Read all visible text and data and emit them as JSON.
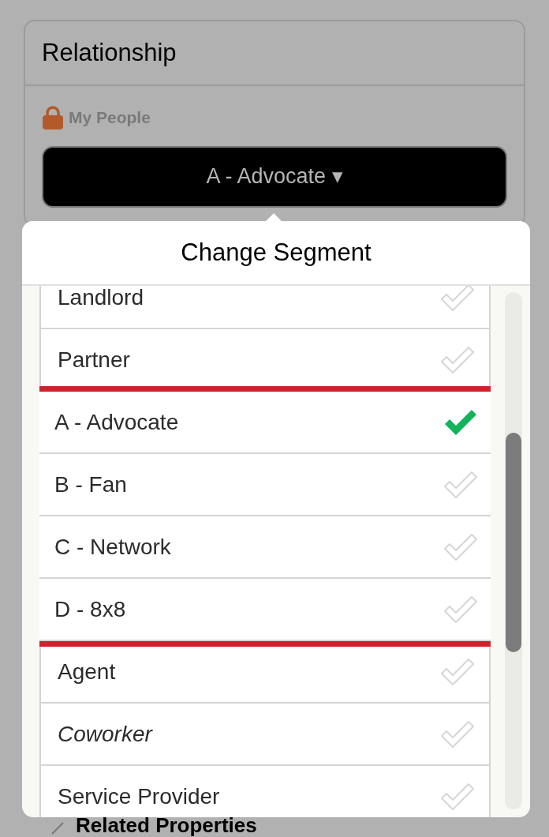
{
  "card": {
    "title": "Relationship",
    "lock_label": "My People",
    "segment_button": "A - Advocate ▾"
  },
  "popover": {
    "title": "Change Segment",
    "items": [
      {
        "label": "Landlord",
        "selected": false,
        "italic": false,
        "highlighted": false
      },
      {
        "label": "Partner",
        "selected": false,
        "italic": false,
        "highlighted": false
      },
      {
        "label": "A - Advocate",
        "selected": true,
        "italic": false,
        "highlighted": true
      },
      {
        "label": "B - Fan",
        "selected": false,
        "italic": false,
        "highlighted": true
      },
      {
        "label": "C - Network",
        "selected": false,
        "italic": false,
        "highlighted": true
      },
      {
        "label": "D - 8x8",
        "selected": false,
        "italic": false,
        "highlighted": true
      },
      {
        "label": "Agent",
        "selected": false,
        "italic": false,
        "highlighted": false
      },
      {
        "label": "Coworker",
        "selected": false,
        "italic": true,
        "highlighted": false
      },
      {
        "label": "Service Provider",
        "selected": false,
        "italic": false,
        "highlighted": false
      }
    ]
  },
  "next_section": {
    "title": "Related Properties"
  }
}
